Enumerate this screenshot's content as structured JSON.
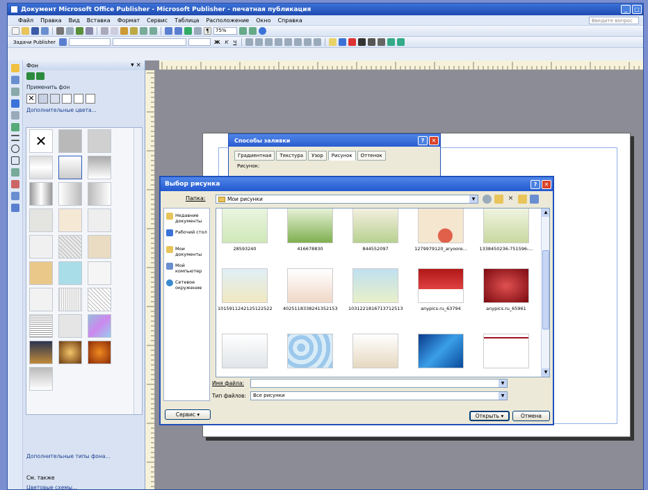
{
  "window": {
    "title": "Документ Microsoft Office Publisher - Microsoft Publisher - печатная публикация"
  },
  "menu": {
    "items": [
      "Файл",
      "Правка",
      "Вид",
      "Вставка",
      "Формат",
      "Сервис",
      "Таблица",
      "Расположение",
      "Окно",
      "Справка"
    ],
    "ask_placeholder": "Введите вопрос"
  },
  "toolbar": {
    "zoom": "75%",
    "publisher_tasks": "Задачи Publisher"
  },
  "taskpane": {
    "title": "Фон",
    "apply_label": "Применить фон",
    "more_colors": "Дополнительные цвета...",
    "more_types": "Дополнительные типы фона...",
    "see_also": "См. также",
    "color_schemes": "Цветовые схемы..."
  },
  "fill_dialog": {
    "title": "Способы заливки",
    "tabs": [
      "Градиентная",
      "Текстура",
      "Узор",
      "Рисунок",
      "Оттенок"
    ],
    "active_tab": 3,
    "picture_label": "Рисунок:"
  },
  "picture_dialog": {
    "title": "Выбор рисунка",
    "look_in_label": "Папка:",
    "look_in_value": "Мои рисунки",
    "places": [
      "Недавние документы",
      "Рабочий стол",
      "Мои документы",
      "Мой компьютер",
      "Сетевое окружение"
    ],
    "files": [
      "28593240",
      "416678830",
      "844552097",
      "1279979120_aryoore...",
      "1338450236-751596-...",
      "1015911242125122522...",
      "4025118338241352153...",
      "10312218167137125130...",
      "anypics.ru_63794",
      "anypics.ru_65961",
      "",
      "",
      "",
      "",
      ""
    ],
    "filename_label": "Имя файла:",
    "filename_value": "",
    "filetype_label": "Тип файлов:",
    "filetype_value": "Все рисунки",
    "tools_button": "Сервис",
    "open_button": "Открыть",
    "cancel_button": "Отмена"
  }
}
